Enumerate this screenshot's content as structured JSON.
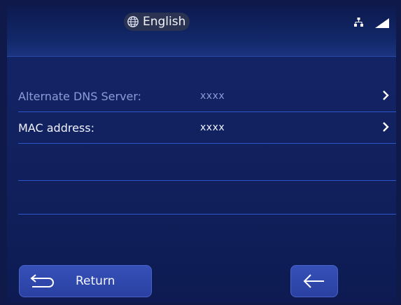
{
  "header": {
    "language_label": "English",
    "icons": [
      "globe-icon",
      "network-icon",
      "signal-icon"
    ]
  },
  "rows": [
    {
      "label": "Alternate DNS Server:",
      "value": "xxxx"
    },
    {
      "label": "MAC address:",
      "value": "xxxx"
    }
  ],
  "footer": {
    "return_label": "Return"
  },
  "colors": {
    "background": "#11205c",
    "divider": "#2d57c8",
    "button": "#2f48ae",
    "dim_text": "#8c9bd8"
  }
}
